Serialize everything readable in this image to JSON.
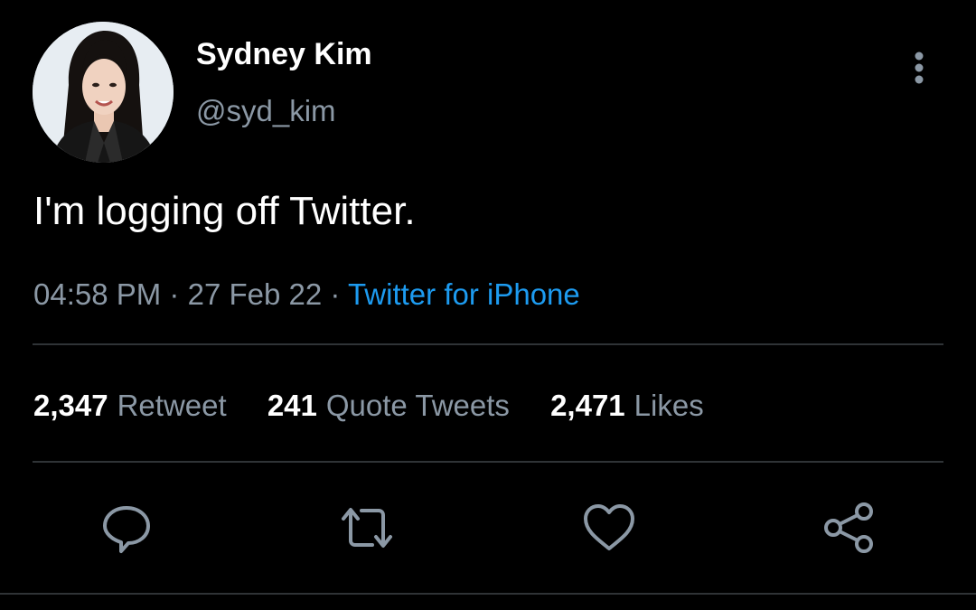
{
  "theme": {
    "background": "#000000",
    "text_primary": "#ffffff",
    "text_secondary": "#8b98a5",
    "accent": "#1d9bf0",
    "divider": "#2f3336"
  },
  "author": {
    "display_name": "Sydney Kim",
    "handle": "@syd_kim",
    "avatar_icon": "profile-photo"
  },
  "tweet": {
    "text": "I'm logging off Twitter.",
    "time": "04:58 PM",
    "date": "27 Feb 22",
    "separator": "·",
    "source": "Twitter for iPhone"
  },
  "stats": [
    {
      "count": "2,347",
      "label": "Retweet"
    },
    {
      "count": "241",
      "label": "Quote Tweets"
    },
    {
      "count": "2,471",
      "label": "Likes"
    }
  ],
  "actions": [
    {
      "name": "reply",
      "icon": "speech-bubble-icon"
    },
    {
      "name": "retweet",
      "icon": "retweet-arrows-icon"
    },
    {
      "name": "like",
      "icon": "heart-icon"
    },
    {
      "name": "share",
      "icon": "share-nodes-icon"
    }
  ],
  "menu": {
    "icon": "vertical-ellipsis-icon"
  }
}
